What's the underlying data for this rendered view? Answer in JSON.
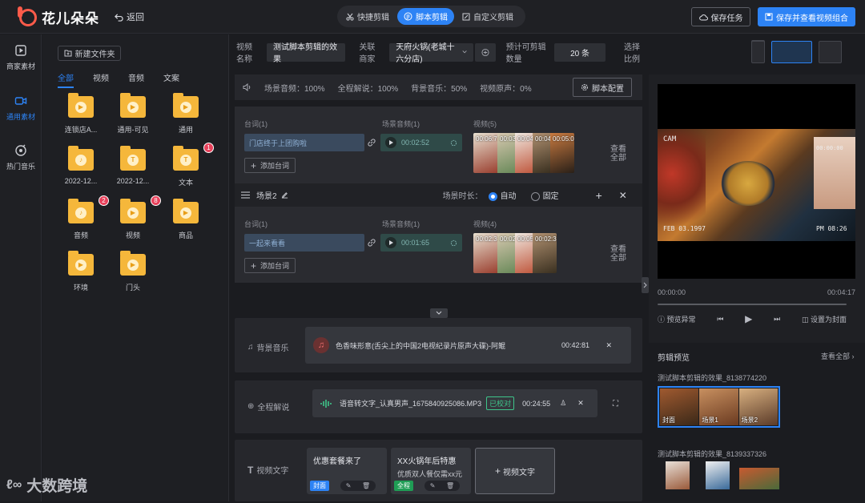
{
  "header": {
    "app_name": "花儿朵朵",
    "back_label": "返回",
    "modes": [
      {
        "label": "快捷剪辑",
        "active": false
      },
      {
        "label": "脚本剪辑",
        "active": true
      },
      {
        "label": "自定义剪辑",
        "active": false
      }
    ],
    "save_task_label": "保存任务",
    "save_combo_label": "保存并查看视频组合"
  },
  "leftnav": {
    "items": [
      {
        "label": "商家素材",
        "icon": "play-square-icon",
        "active": false
      },
      {
        "label": "通用素材",
        "icon": "video-camera-icon",
        "active": true
      },
      {
        "label": "热门音乐",
        "icon": "music-disc-icon",
        "active": false
      }
    ]
  },
  "library": {
    "new_folder_label": "新建文件夹",
    "tabs": [
      "全部",
      "视频",
      "音频",
      "文案"
    ],
    "active_tab": "全部",
    "folders": [
      {
        "label": "连锁店A...",
        "type": "video",
        "badge": ""
      },
      {
        "label": "通用-可见",
        "type": "video",
        "badge": ""
      },
      {
        "label": "通用",
        "type": "video",
        "badge": ""
      },
      {
        "label": "2022-12...",
        "type": "audio",
        "badge": ""
      },
      {
        "label": "2022-12...",
        "type": "text",
        "badge": ""
      },
      {
        "label": "文本",
        "type": "text",
        "badge": "1"
      },
      {
        "label": "音频",
        "type": "audio",
        "badge": "2"
      },
      {
        "label": "视频",
        "type": "video",
        "badge": "8"
      },
      {
        "label": "商品",
        "type": "video",
        "badge": ""
      },
      {
        "label": "环境",
        "type": "video",
        "badge": ""
      },
      {
        "label": "门头",
        "type": "video",
        "badge": ""
      }
    ]
  },
  "editor": {
    "video_name_label": "视频名称",
    "video_name_value": "测试脚本剪辑的效果",
    "merchant_label": "关联商家",
    "merchant_value": "天府火锅(老城十六分店)",
    "count_label": "预计可剪辑数量",
    "count_value": "20 条",
    "ratio_label": "选择比例",
    "volume_bar": {
      "scene_audio": "场景音频：100%",
      "narration": "全程解说：100%",
      "bgm": "背景音乐：50%",
      "original": "视频原声：0%",
      "config_label": "脚本配置"
    },
    "scene1": {
      "lines_label": "台词(1)",
      "line_value": "门店终于上团购啦",
      "add_line_label": "添加台词",
      "audio_label": "场景音频(1)",
      "audio_time": "00:02:52",
      "video_label": "视频(5)",
      "video_times": [
        "00:06:73",
        "00:03:90",
        "00:04:55",
        "00:04:57",
        "00:05:00"
      ],
      "see_all": "查看全部"
    },
    "scene2": {
      "title": "场景2",
      "duration_label": "场景时长：",
      "auto_label": "自动",
      "fixed_label": "固定",
      "lines_label": "台词(1)",
      "line_value": "一起来看看",
      "add_line_label": "添加台词",
      "audio_label": "场景音频(1)",
      "audio_time": "00:01:65",
      "video_label": "视频(4)",
      "video_times": [
        "00:02:33",
        "00:02:33",
        "00:05:00",
        "00:02:33"
      ],
      "see_all": "查看全部"
    },
    "bgm": {
      "label": "背景音乐",
      "track": "色香味形意(舌尖上的中国2电视纪录片原声大碟)-阿鲲",
      "time": "00:42:81"
    },
    "narration": {
      "label": "全程解说",
      "file": "语音转文字_认真男声_1675840925086.MP3",
      "status": "已校对",
      "time": "00:24:55"
    },
    "video_text": {
      "label": "视频文字",
      "cards": [
        {
          "title": "优惠套餐来了",
          "subtitle": "",
          "tag": "封面",
          "tag_color": "#2d83f5"
        },
        {
          "title": "XX火锅年后特惠",
          "subtitle": "优质双人餐仅需xx元",
          "tag": "全程",
          "tag_color": "#1f9d55"
        }
      ],
      "add_label": "视频文字"
    }
  },
  "preview": {
    "cam_text": "CAM",
    "date_text": "FEB 03.1997",
    "time_text": "PM 08:26",
    "ts_text": "00:00:00",
    "time_start": "00:00:00",
    "time_end": "00:04:17",
    "preview_issue": "预览异常",
    "set_cover": "设置为封面",
    "clip_preview_label": "剪辑预览",
    "see_all": "查看全部",
    "group1_name": "测试脚本剪辑的效果_8138774220",
    "group1_labels": [
      "封面",
      "场景1",
      "场景2"
    ],
    "group2_name": "测试脚本剪辑的效果_8139337326"
  },
  "watermark": "大数跨境"
}
